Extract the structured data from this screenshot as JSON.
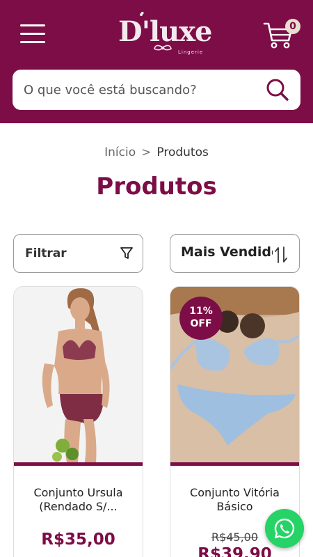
{
  "header": {
    "logo_text": "D'luxe",
    "logo_subtitle": "Lingerie",
    "cart_count": "0"
  },
  "search": {
    "placeholder": "O que você está buscando?"
  },
  "breadcrumb": {
    "home": "Início",
    "separator": ">",
    "current": "Produtos"
  },
  "page_title": "Produtos",
  "toolbar": {
    "filter_label": "Filtrar",
    "sort_label": "Mais Vendidos"
  },
  "products": [
    {
      "name": "Conjunto Ursula (Rendado S/...",
      "price": "R$35,00"
    },
    {
      "name": "Conjunto Vitória Básico",
      "discount": "11% OFF",
      "old_price": "R$45,00",
      "price": "R$39,90"
    }
  ],
  "colors": {
    "brand": "#7c0d46",
    "whatsapp": "#25d366"
  }
}
